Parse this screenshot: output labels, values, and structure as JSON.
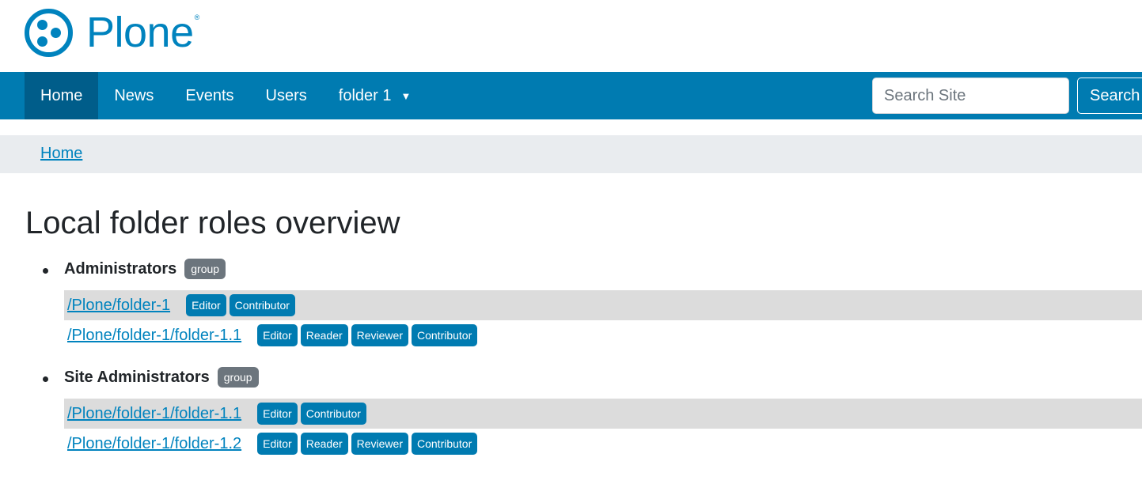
{
  "brand": {
    "name": "Plone",
    "registered": "®",
    "color": "#0083be"
  },
  "nav": {
    "items": [
      {
        "label": "Home"
      },
      {
        "label": "News"
      },
      {
        "label": "Events"
      },
      {
        "label": "Users"
      },
      {
        "label": "folder 1"
      }
    ],
    "dropdown_caret": "▼",
    "color": "#007bb1",
    "active_color": "#005d8a"
  },
  "search": {
    "placeholder": "Search Site",
    "button_label": "Search"
  },
  "breadcrumb": {
    "home_label": "Home"
  },
  "page": {
    "title": "Local folder roles overview"
  },
  "groups": [
    {
      "name": "Administrators",
      "badge": "group",
      "folders": [
        {
          "path": "/Plone/folder-1",
          "roles": [
            "Editor",
            "Contributor"
          ]
        },
        {
          "path": "/Plone/folder-1/folder-1.1",
          "roles": [
            "Editor",
            "Reader",
            "Reviewer",
            "Contributor"
          ]
        }
      ]
    },
    {
      "name": "Site Administrators",
      "badge": "group",
      "folders": [
        {
          "path": "/Plone/folder-1/folder-1.1",
          "roles": [
            "Editor",
            "Contributor"
          ]
        },
        {
          "path": "/Plone/folder-1/folder-1.2",
          "roles": [
            "Editor",
            "Reader",
            "Reviewer",
            "Contributor"
          ]
        }
      ]
    }
  ]
}
